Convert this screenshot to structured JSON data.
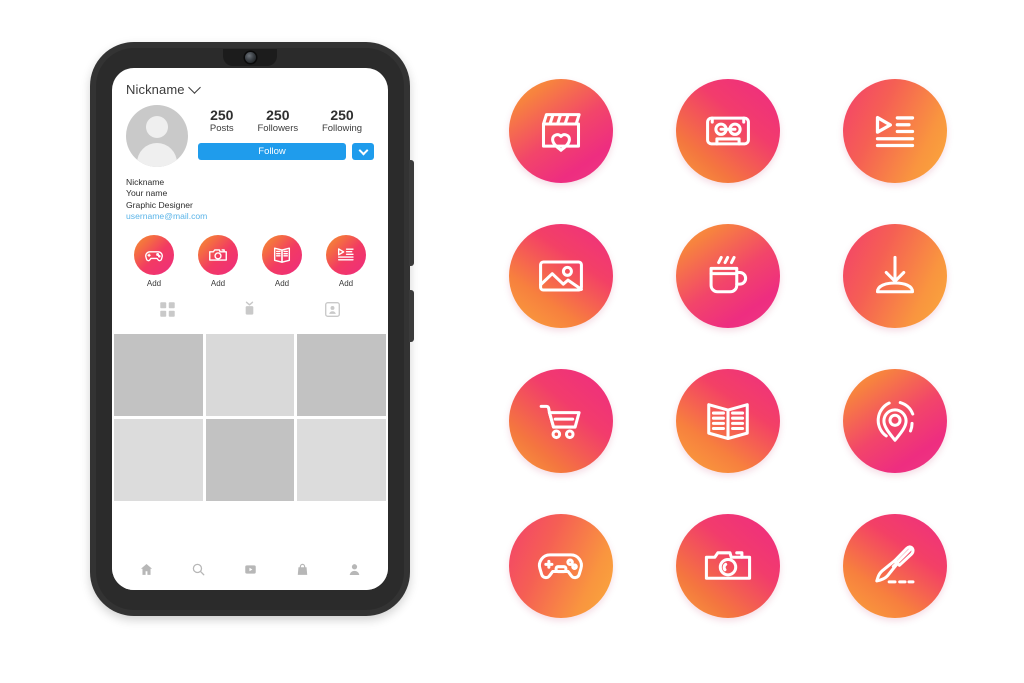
{
  "phone": {
    "header": {
      "nickname": "Nickname",
      "chevron_icon": "chevron-down-icon"
    },
    "avatar": {
      "icon": "avatar-person-icon"
    },
    "stats": [
      {
        "value": "250",
        "label": "Posts"
      },
      {
        "value": "250",
        "label": "Followers"
      },
      {
        "value": "250",
        "label": "Following"
      }
    ],
    "actions": {
      "follow_label": "Follow",
      "follow_color": "#1f9cec",
      "dropdown_icon": "chevron-down-icon"
    },
    "bio": {
      "nickname": "Nickname",
      "name": "Your name",
      "role": "Graphic Designer",
      "email": "username@mail.com",
      "email_color": "#5bb4e8"
    },
    "highlights": [
      {
        "icon": "gamepad-icon",
        "label": "Add"
      },
      {
        "icon": "camera-icon",
        "label": "Add"
      },
      {
        "icon": "open-book-icon",
        "label": "Add"
      },
      {
        "icon": "playlist-icon",
        "label": "Add"
      }
    ],
    "gallery_tabs": [
      {
        "icon": "grid-icon",
        "active": true
      },
      {
        "icon": "reels-tv-icon",
        "active": false
      },
      {
        "icon": "tagged-person-icon",
        "active": false
      }
    ],
    "photo_grid": {
      "tiles": [
        {
          "shade": "#c2c2c2"
        },
        {
          "shade": "#d9d9d9"
        },
        {
          "shade": "#c2c2c2"
        },
        {
          "shade": "#dcdcdc"
        },
        {
          "shade": "#c2c2c2"
        },
        {
          "shade": "#dcdcdc"
        }
      ]
    },
    "bottom_nav": [
      {
        "icon": "home-icon"
      },
      {
        "icon": "search-icon"
      },
      {
        "icon": "reels-play-icon"
      },
      {
        "icon": "shopping-bag-icon"
      },
      {
        "icon": "profile-person-icon"
      }
    ],
    "hardware": {
      "front_camera_icon": "front-camera-lens-icon",
      "volume_button": "side-button-volume",
      "power_button": "side-button-power"
    }
  },
  "icon_set": {
    "gradient_start": "#f9a33c",
    "gradient_end": "#ee2d80",
    "icons": [
      {
        "name": "clapperboard-heart-icon",
        "style": "g-a"
      },
      {
        "name": "cassette-tape-icon",
        "style": "g-b"
      },
      {
        "name": "playlist-icon",
        "style": "g-c"
      },
      {
        "name": "photo-image-icon",
        "style": "g-d"
      },
      {
        "name": "coffee-cup-icon",
        "style": "g-a"
      },
      {
        "name": "download-icon",
        "style": "g-c"
      },
      {
        "name": "shopping-cart-icon",
        "style": "g-b"
      },
      {
        "name": "open-book-icon",
        "style": "g-d"
      },
      {
        "name": "location-pin-icon",
        "style": "g-a"
      },
      {
        "name": "gamepad-icon",
        "style": "g-c"
      },
      {
        "name": "camera-icon",
        "style": "g-b"
      },
      {
        "name": "paintbrush-icon",
        "style": "g-d"
      }
    ]
  }
}
